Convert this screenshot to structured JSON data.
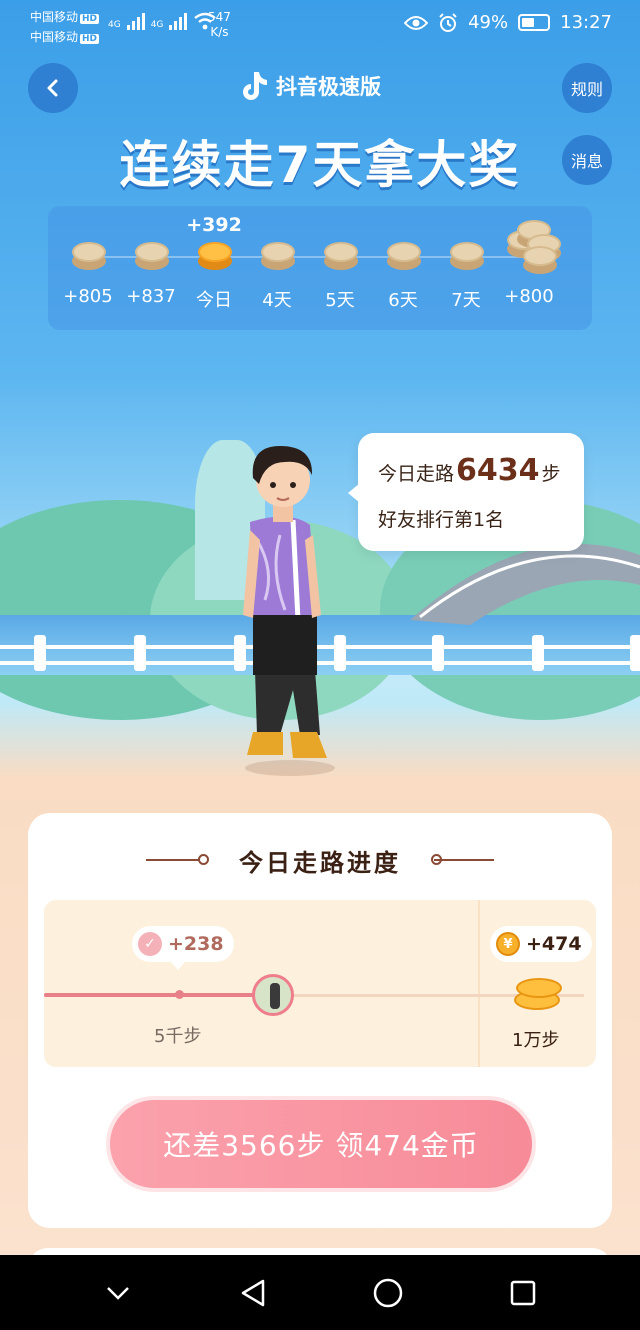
{
  "status_bar": {
    "carrier1": "中国移动",
    "carrier2": "中国移动",
    "hd": "HD",
    "net": "4G",
    "speed_value": "547",
    "speed_unit": "K/s",
    "battery": "49%",
    "time": "13:27"
  },
  "header": {
    "brand": "抖音极速版",
    "rules": "规则",
    "messages": "消息",
    "headline": "连续走7天拿大奖"
  },
  "calendar": {
    "today_bonus": "+392",
    "days": [
      {
        "label": "+805",
        "type": "past"
      },
      {
        "label": "+837",
        "type": "past"
      },
      {
        "label": "今日",
        "type": "today"
      },
      {
        "label": "4天",
        "type": "future"
      },
      {
        "label": "5天",
        "type": "future"
      },
      {
        "label": "6天",
        "type": "future"
      },
      {
        "label": "7天",
        "type": "future"
      },
      {
        "label": "+800",
        "type": "grand"
      }
    ]
  },
  "bubble": {
    "prefix": "今日走路",
    "steps": "6434",
    "suffix": "步",
    "rank": "好友排行第1名"
  },
  "progress": {
    "title": "今日走路进度",
    "milestone1_reward": "+238",
    "milestone1_label": "5千步",
    "milestone2_reward": "+474",
    "milestone2_label": "1万步",
    "progress_fraction": 0.6434,
    "button": "还差3566步 领474金币"
  },
  "colors": {
    "sky": "#3b9ee8",
    "accent_pink": "#f78b98",
    "text_brown": "#3b2014"
  }
}
